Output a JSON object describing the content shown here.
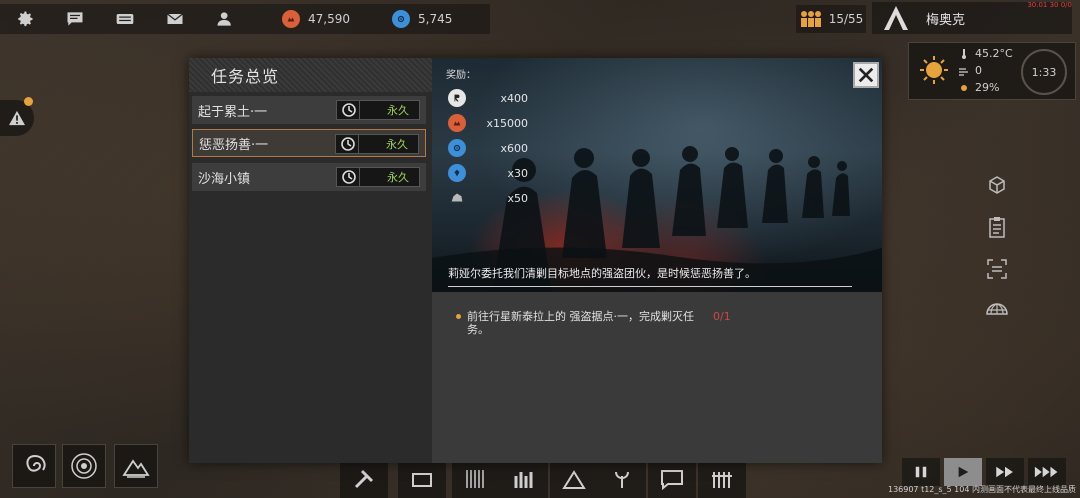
{
  "top_bar": {
    "buttons": [
      {
        "name": "settings",
        "icon": "gear-icon"
      },
      {
        "name": "chat",
        "icon": "chat-icon"
      },
      {
        "name": "keyboard",
        "icon": "keyboard-icon"
      },
      {
        "name": "mail",
        "icon": "mail-icon"
      },
      {
        "name": "profile",
        "icon": "person-icon"
      }
    ],
    "resources": [
      {
        "icon": "red-resource-icon",
        "value": "47,590",
        "color": "#d9603b"
      },
      {
        "icon": "blue-resource-icon",
        "value": "5,745",
        "color": "#3d8fd8"
      }
    ]
  },
  "population": {
    "value": "15/55"
  },
  "player": {
    "name": "梅奥克"
  },
  "debug_text": "30.01 30 0/0",
  "weather": {
    "temperature": "45.2°C",
    "wind": "0",
    "humidity": "29%",
    "time": "1:33"
  },
  "modal": {
    "title": "任务总览",
    "quests": [
      {
        "name": "起于累土·一",
        "status": "永久",
        "selected": false
      },
      {
        "name": "惩恶扬善·一",
        "status": "永久",
        "selected": true
      },
      {
        "name": "沙海小镇",
        "status": "永久",
        "selected": false
      }
    ],
    "reward_title": "奖励：",
    "rewards": [
      {
        "icon": "r-token-icon",
        "amount": "x400",
        "color": "#e6e6e6"
      },
      {
        "icon": "red-resource-icon",
        "amount": "x15000",
        "color": "#d9603b"
      },
      {
        "icon": "blue-resource-icon",
        "amount": "x600",
        "color": "#3d8fd8"
      },
      {
        "icon": "blue-emblem-icon",
        "amount": "x30",
        "color": "#3d8fd8"
      },
      {
        "icon": "stone-icon",
        "amount": "x50",
        "color": "#b9b9b9"
      }
    ],
    "story": "莉娅尔委托我们清剿目标地点的强盗团伙，是时候惩恶扬善了。",
    "objective": {
      "text": "前往行星新泰拉上的 强盗据点·一，完成剿灭任务。",
      "progress": "0/1"
    }
  },
  "footer_note": "136907 t12_s_5 104 内测画面不代表最终上线品质",
  "speed_controls": [
    "pause",
    "play",
    "fast",
    "faster"
  ]
}
